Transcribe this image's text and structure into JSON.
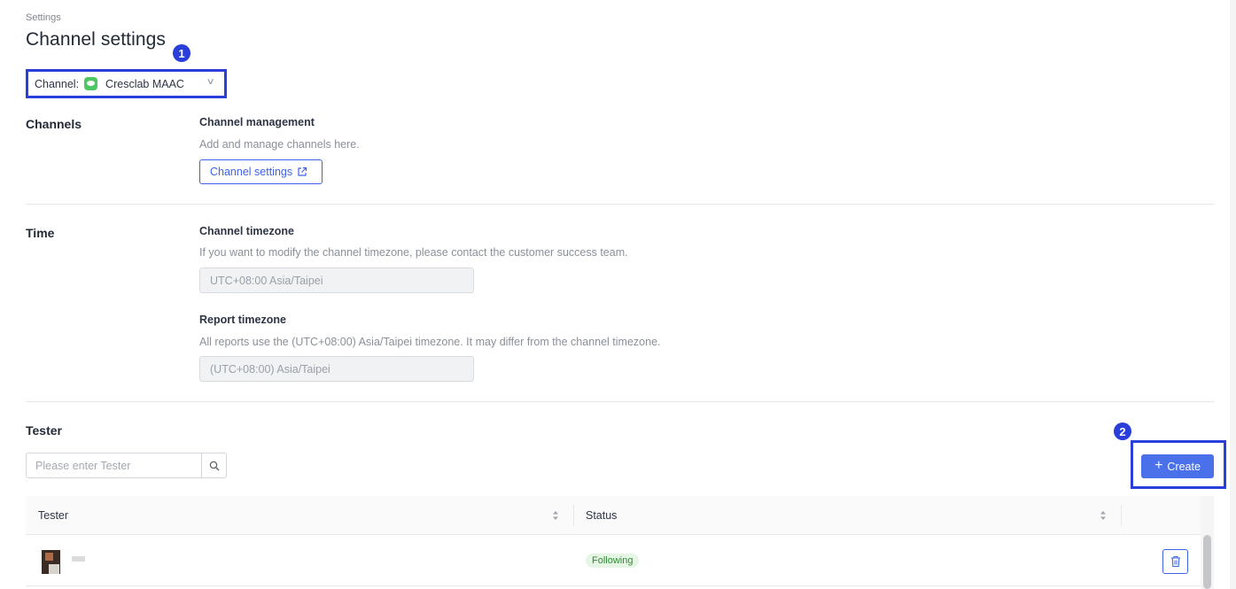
{
  "breadcrumb": "Settings",
  "page_title": "Channel settings",
  "markers": [
    "1",
    "2"
  ],
  "channel_select": {
    "label": "Channel:",
    "value": "Cresclab MAAC",
    "logo_icon": "line-logo-icon"
  },
  "channels_section": {
    "label": "Channels",
    "subtitle": "Channel management",
    "description": "Add and manage channels here.",
    "button_label": "Channel settings"
  },
  "time_section": {
    "label": "Time",
    "channel_timezone_title": "Channel timezone",
    "channel_timezone_desc": "If you want to modify the channel timezone, please contact the customer success team.",
    "channel_timezone_value": "UTC+08:00 Asia/Taipei",
    "report_timezone_title": "Report timezone",
    "report_timezone_desc": "All reports use the (UTC+08:00) Asia/Taipei timezone. It may differ from the channel timezone.",
    "report_timezone_value": "(UTC+08:00) Asia/Taipei"
  },
  "tester_section": {
    "label": "Tester",
    "search_placeholder": "Please enter Tester",
    "create_label": "Create",
    "columns": [
      "Tester",
      "Status"
    ],
    "rows": [
      {
        "status": "Following"
      }
    ]
  },
  "colors": {
    "accent": "#3f63e8",
    "annotation": "#2a3ed9",
    "following_badge_bg": "#e6f6e4",
    "following_badge_text": "#2e8a36"
  }
}
